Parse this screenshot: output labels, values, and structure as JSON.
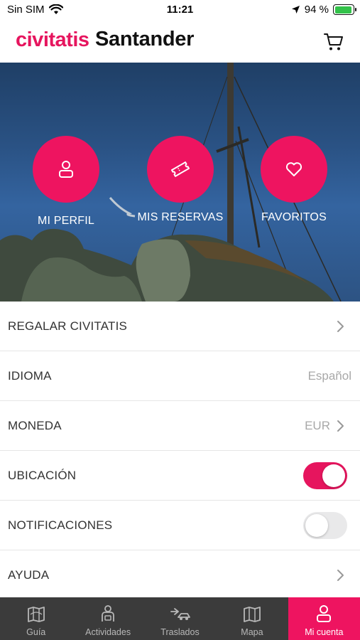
{
  "status_bar": {
    "carrier": "Sin SIM",
    "time": "11:21",
    "battery_percent": "94 %",
    "battery_level": 0.94,
    "icons": [
      "wifi-icon",
      "location-arrow-icon",
      "battery-charging-icon"
    ]
  },
  "header": {
    "logo": "civitatis",
    "city": "Santander",
    "cart_icon": "cart-icon",
    "brand_color": "#e6155e"
  },
  "hero": {
    "actions": [
      {
        "label": "MI PERFIL",
        "icon": "user-icon"
      },
      {
        "label": "MIS RESERVAS",
        "icon": "ticket-icon"
      },
      {
        "label": "FAVORITOS",
        "icon": "heart-icon"
      }
    ]
  },
  "settings": {
    "gift": {
      "label": "REGALAR CIVITATIS"
    },
    "language": {
      "label": "IDIOMA",
      "value": "Español"
    },
    "currency": {
      "label": "MONEDA",
      "value": "EUR"
    },
    "location": {
      "label": "UBICACIÓN",
      "enabled": true
    },
    "notifications": {
      "label": "NOTIFICACIONES",
      "enabled": false
    },
    "help": {
      "label": "AYUDA"
    }
  },
  "tab_bar": {
    "active_color": "#ee1460",
    "tabs": [
      {
        "label": "Guía",
        "icon": "map-book-icon",
        "active": false
      },
      {
        "label": "Actividades",
        "icon": "guide-person-icon",
        "active": false
      },
      {
        "label": "Traslados",
        "icon": "transfer-car-icon",
        "active": false
      },
      {
        "label": "Mapa",
        "icon": "map-icon",
        "active": false
      },
      {
        "label": "Mi cuenta",
        "icon": "user-icon",
        "active": true
      }
    ]
  }
}
